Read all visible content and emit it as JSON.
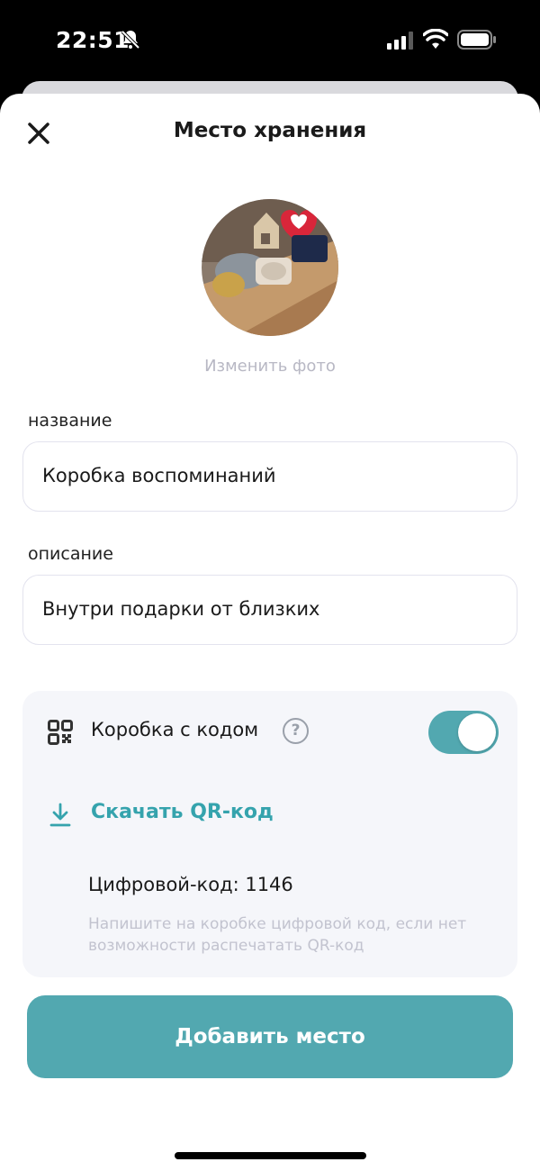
{
  "status_bar": {
    "time": "22:51",
    "icons": [
      "bell-slash-icon",
      "signal-icon",
      "wifi-icon",
      "battery-icon"
    ]
  },
  "header": {
    "title": "Место хранения",
    "close_icon": "close-icon"
  },
  "photo": {
    "change_label": "Изменить фото"
  },
  "form": {
    "name": {
      "label": "название",
      "value": "Коробка воспоминаний"
    },
    "description": {
      "label": "описание",
      "value": "Внутри подарки от близких"
    }
  },
  "qr_card": {
    "toggle_label": "Коробка с кодом",
    "help_icon": "?",
    "toggle_on": true,
    "download_label": "Скачать QR-код",
    "code_line": "Цифровой-код: 1146",
    "hint": "Напишите на коробке цифровой код, если нет возможности распечатать QR-код"
  },
  "submit_label": "Добавить место",
  "colors": {
    "accent": "#52a8b0",
    "link": "#35a3ad",
    "card_bg": "#f5f6fa",
    "muted_text": "#c2c3cf"
  }
}
